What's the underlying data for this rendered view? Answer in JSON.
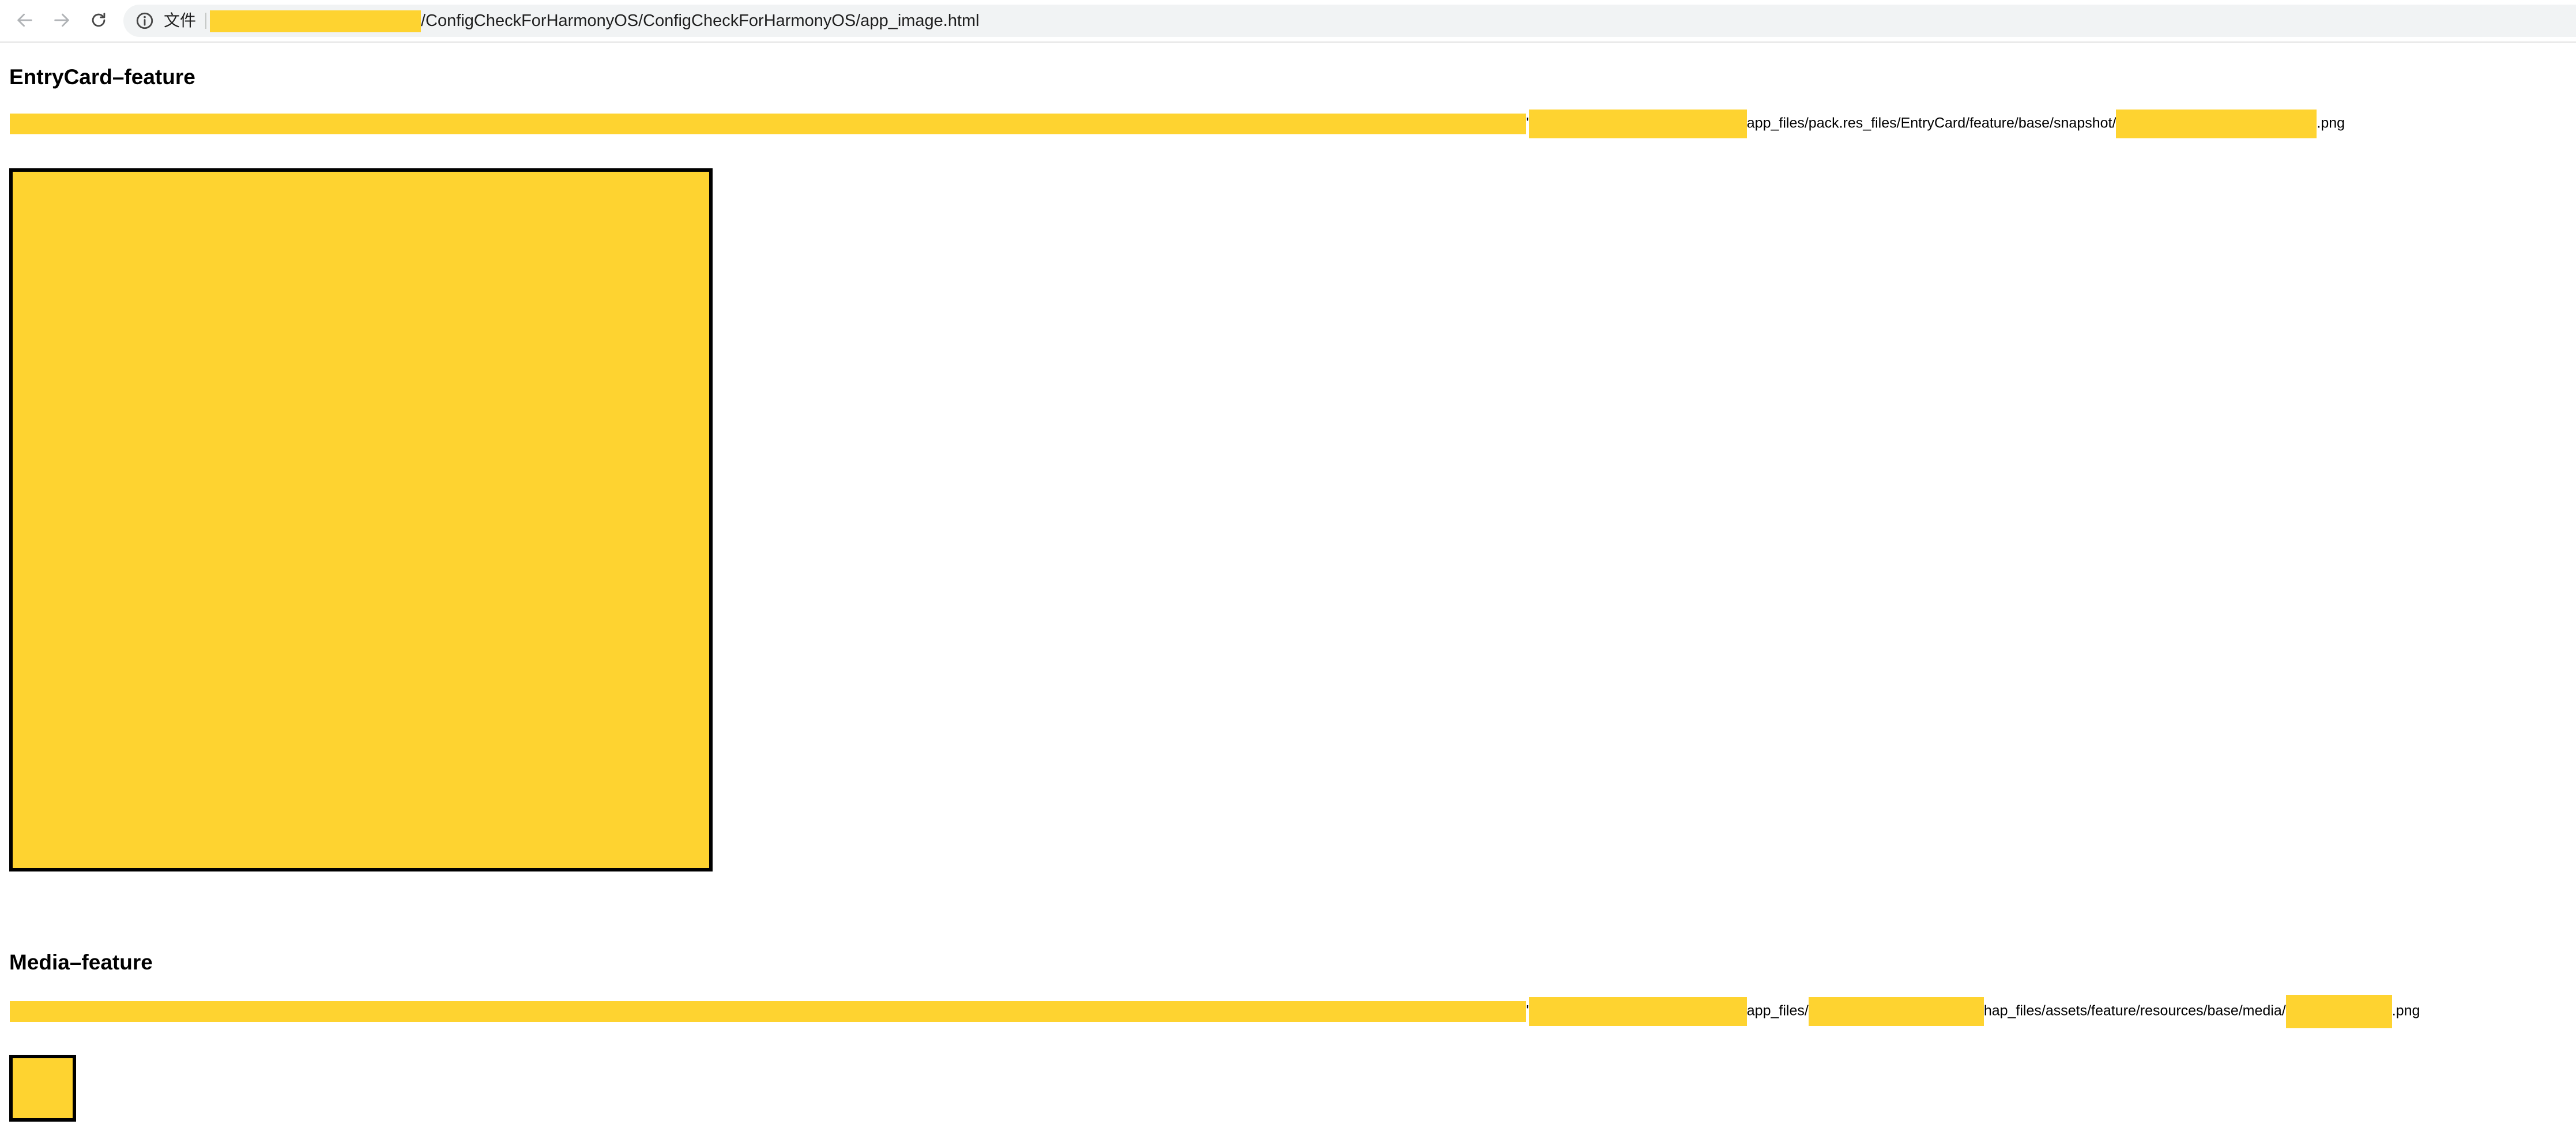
{
  "browser": {
    "scheme_label": "文件",
    "url_suffix": "/ConfigCheckForHarmonyOS/ConfigCheckForHarmonyOS/app_image.html",
    "redaction_color": "#fed330"
  },
  "sections": [
    {
      "title": "EntryCard–feature",
      "path": {
        "seg1": "'",
        "seg2": "app_files/pack.res_files/EntryCard/feature/base/snapshot/",
        "seg3": ".png"
      }
    },
    {
      "title": "Media–feature",
      "path": {
        "seg1": "'",
        "seg2": "app_files/",
        "seg3": "hap_files/assets/feature/resources/base/media/",
        "seg4": ".png"
      }
    }
  ]
}
